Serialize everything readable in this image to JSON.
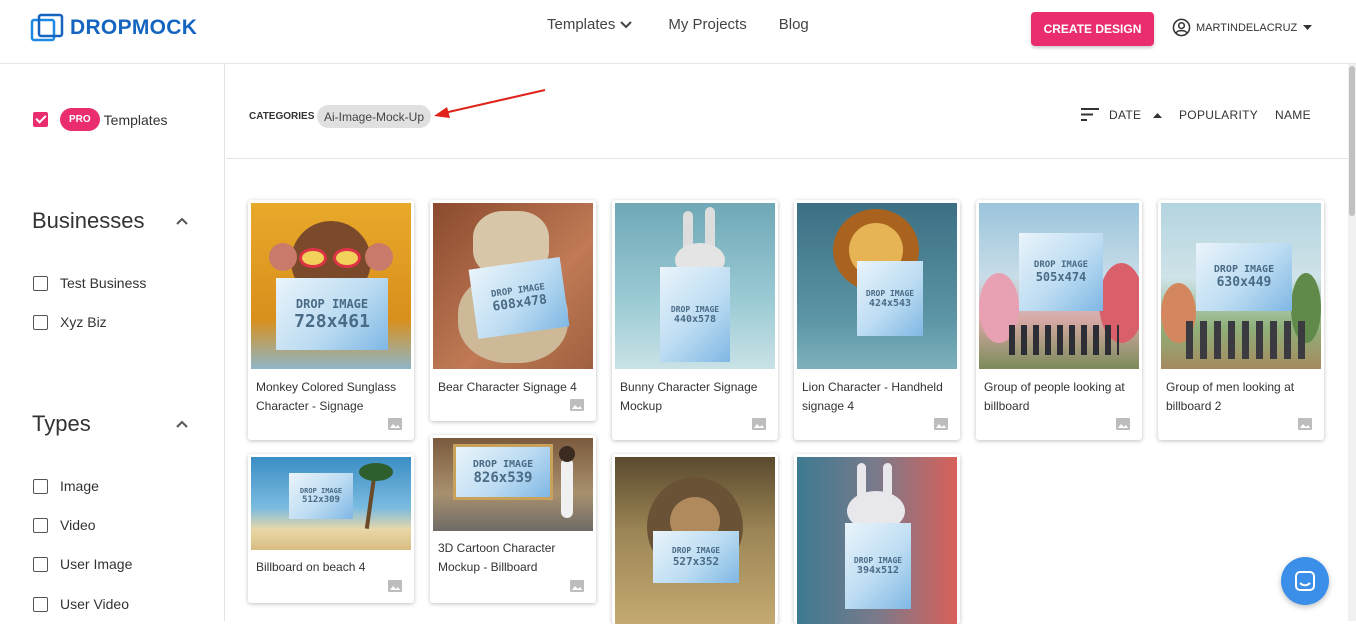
{
  "header": {
    "logo_text": "DROPMOCK",
    "nav": {
      "templates": "Templates",
      "projects": "My Projects",
      "blog": "Blog"
    },
    "create_button": "CREATE DESIGN",
    "username": "MARTINDELACRUZ"
  },
  "sidebar": {
    "pro": {
      "badge": "PRO",
      "label": "Templates",
      "checked": true
    },
    "businesses": {
      "title": "Businesses",
      "items": [
        "Test Business",
        "Xyz Biz"
      ]
    },
    "types": {
      "title": "Types",
      "items": [
        "Image",
        "Video",
        "User Image",
        "User Video"
      ]
    }
  },
  "toolbar": {
    "categories_label": "CATEGORIES",
    "category_chip": "Ai-Image-Mock-Up",
    "sort": {
      "date": "DATE",
      "popularity": "POPULARITY",
      "name": "NAME"
    }
  },
  "cards": [
    {
      "title": "Monkey Colored Sunglass Character - Signage",
      "sign_line1": "DROP IMAGE",
      "sign_line2": "728x461"
    },
    {
      "title": "Bear Character Signage 4",
      "sign_line1": "DROP IMAGE",
      "sign_line2": "608x478"
    },
    {
      "title": "Bunny Character Signage Mockup",
      "sign_line1": "DROP IMAGE",
      "sign_line2": "440x578"
    },
    {
      "title": "Lion Character - Handheld signage 4",
      "sign_line1": "DROP IMAGE",
      "sign_line2": "424x543"
    },
    {
      "title": "Group of people looking at billboard",
      "sign_line1": "DROP IMAGE",
      "sign_line2": "505x474"
    },
    {
      "title": "Group of men looking at billboard 2",
      "sign_line1": "DROP IMAGE",
      "sign_line2": "630x449"
    },
    {
      "title": "Billboard on beach 4",
      "sign_line1": "DROP IMAGE",
      "sign_line2": "512x309"
    },
    {
      "title": "3D Cartoon Character Mockup - Billboard",
      "sign_line1": "DROP IMAGE",
      "sign_line2": "826x539"
    },
    {
      "title": "",
      "sign_line1": "DROP IMAGE",
      "sign_line2": "527x352"
    },
    {
      "title": "",
      "sign_line1": "DROP IMAGE",
      "sign_line2": "394x512"
    }
  ],
  "colors": {
    "accent": "#ea2d6f",
    "brand": "#1565c0",
    "annotation_arrow": "#e0221b"
  }
}
